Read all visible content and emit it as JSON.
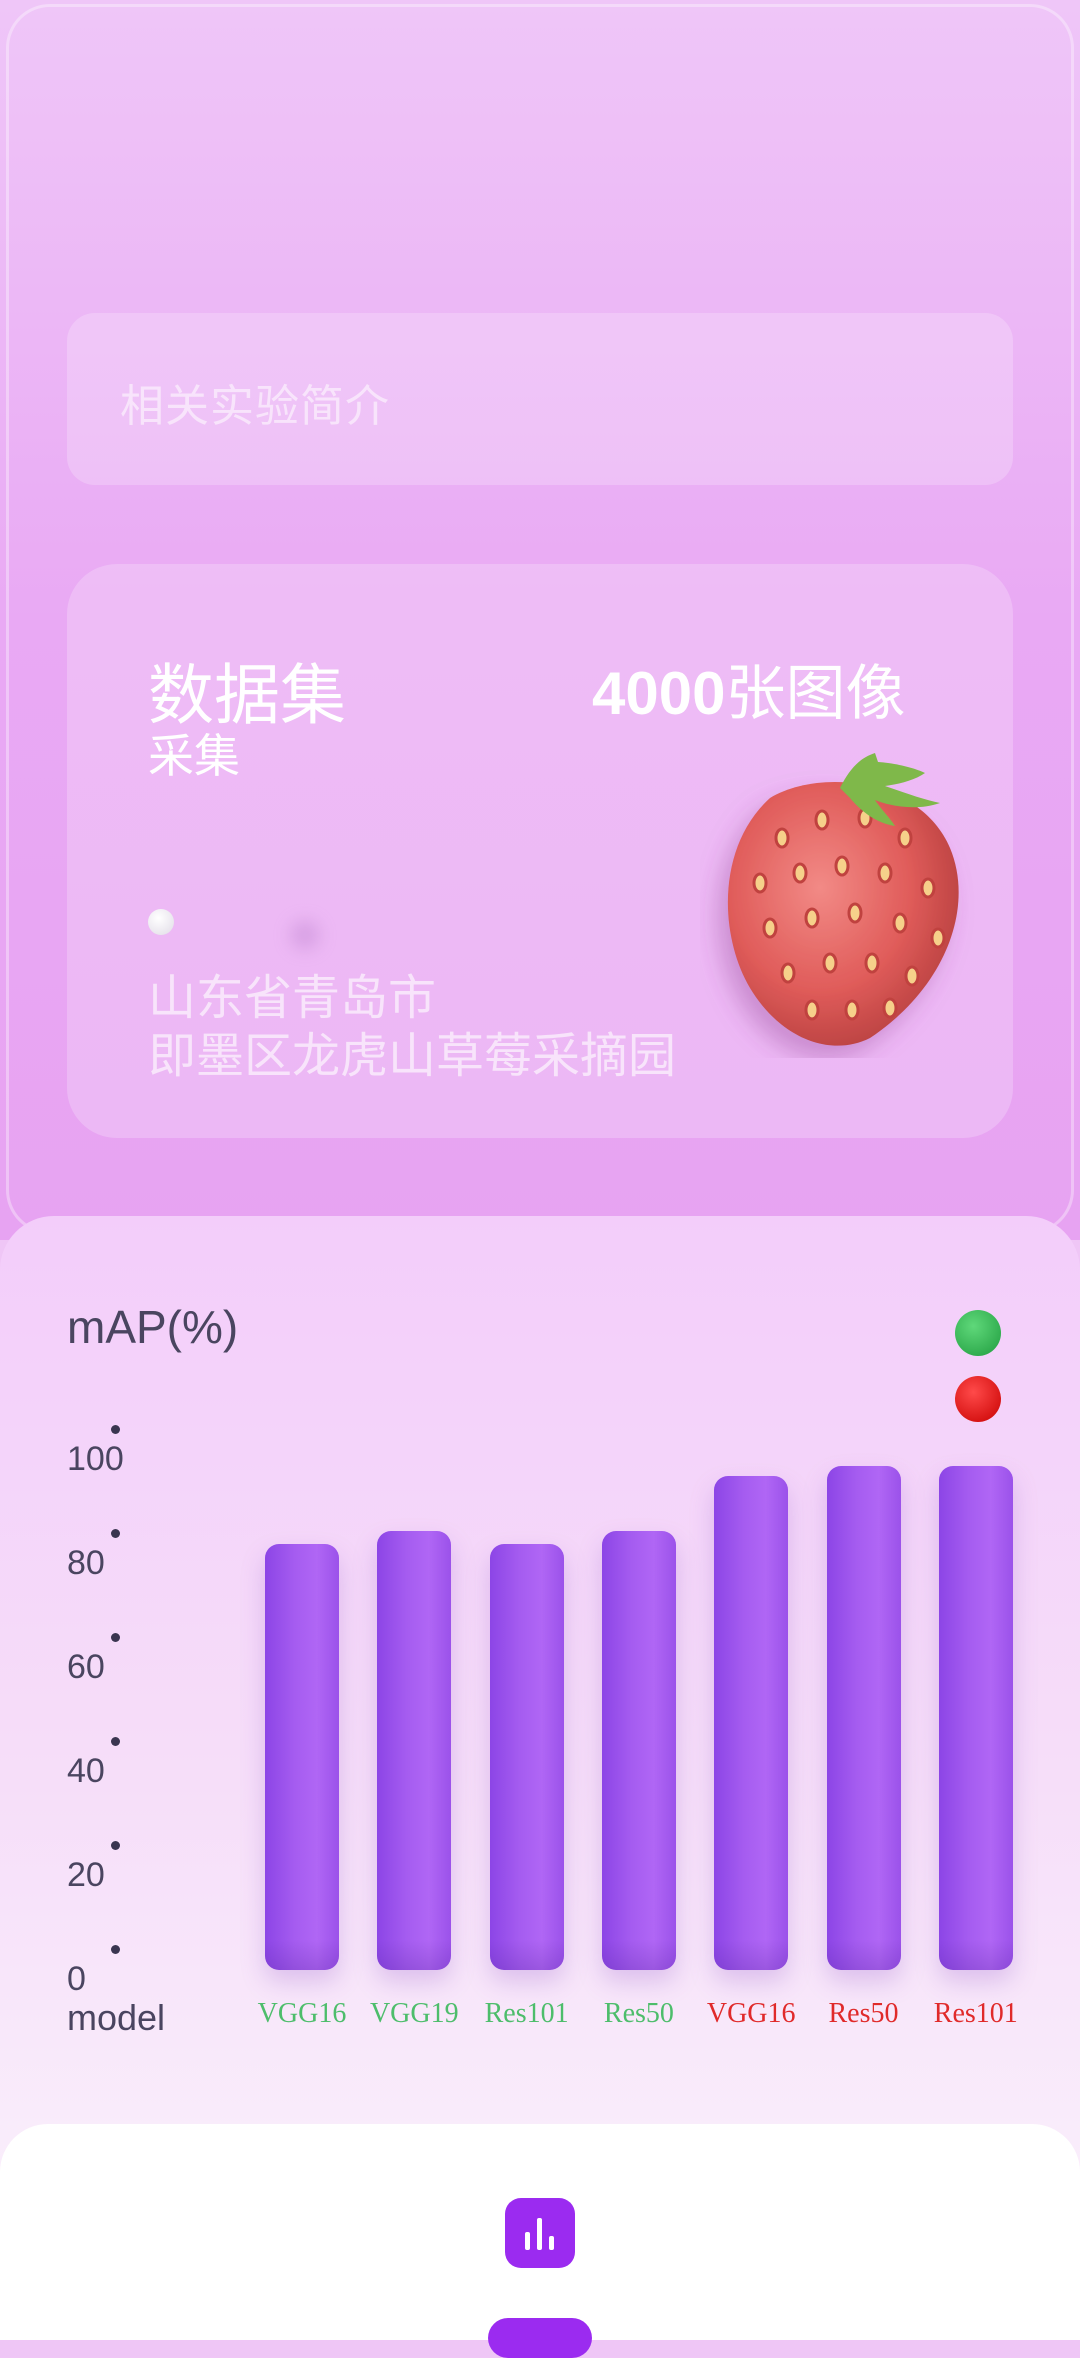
{
  "intro": {
    "placeholder": "相关实验简介"
  },
  "dataset": {
    "title": "数据集",
    "subtitle": "采集",
    "count_number": "4000",
    "count_unit": "张图像",
    "location_line1": "山东省青岛市",
    "location_line2": "即墨区龙虎山草莓采摘园"
  },
  "legend": {
    "colors": [
      "#2fb44e",
      "#e00000"
    ]
  },
  "chart_data": {
    "type": "bar",
    "title": "mAP(%)",
    "xlabel": "model",
    "ylabel": "mAP(%)",
    "ylim": [
      0,
      100
    ],
    "yticks": [
      "100",
      "80",
      "60",
      "40",
      "20",
      "0"
    ],
    "categories": [
      "VGG16",
      "VGG19",
      "Res101",
      "Res50",
      "VGG16",
      "Res50",
      "Res101"
    ],
    "category_colors": [
      "#4dbd6b",
      "#4dbd6b",
      "#4dbd6b",
      "#4dbd6b",
      "#e02a2a",
      "#e02a2a",
      "#e02a2a"
    ],
    "values": [
      82,
      84.5,
      82,
      84.5,
      95,
      97,
      97
    ]
  },
  "nav": {
    "icon": "bar-chart-icon"
  }
}
